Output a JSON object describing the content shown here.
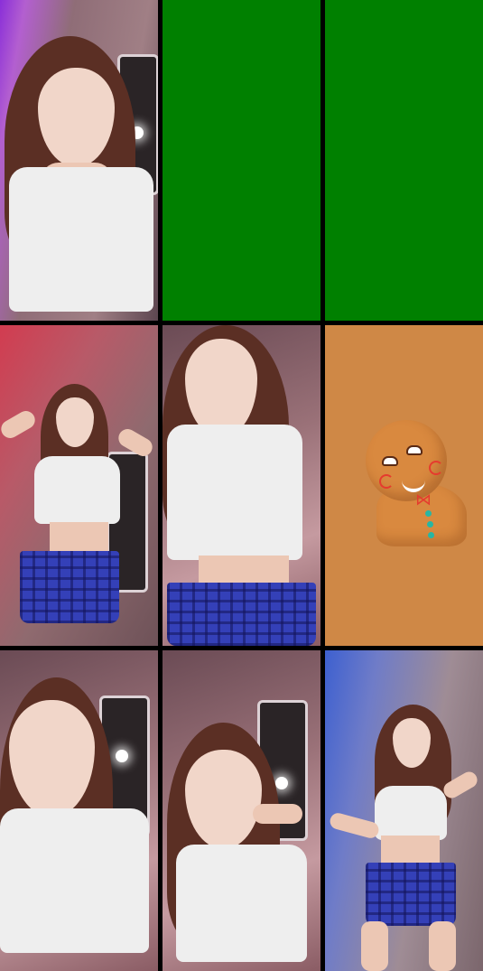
{
  "layout": {
    "title": "",
    "tiles": [
      {
        "id": "tile-1",
        "kind": "video",
        "variant": "purple"
      },
      {
        "id": "tile-2",
        "kind": "empty",
        "color": "#008000"
      },
      {
        "id": "tile-3",
        "kind": "empty",
        "color": "#008000"
      },
      {
        "id": "tile-4",
        "kind": "video",
        "variant": "red"
      },
      {
        "id": "tile-5",
        "kind": "video",
        "variant": "default"
      },
      {
        "id": "tile-6",
        "kind": "avatar",
        "icon": "gingerbread-icon",
        "color": "#cf8846"
      },
      {
        "id": "tile-7",
        "kind": "video",
        "variant": "default"
      },
      {
        "id": "tile-8",
        "kind": "video",
        "variant": "default"
      },
      {
        "id": "tile-9",
        "kind": "video",
        "variant": "blue"
      }
    ]
  },
  "colors": {
    "background": "#000000",
    "empty_slot": "#008000",
    "avatar_background": "#cf8846"
  }
}
